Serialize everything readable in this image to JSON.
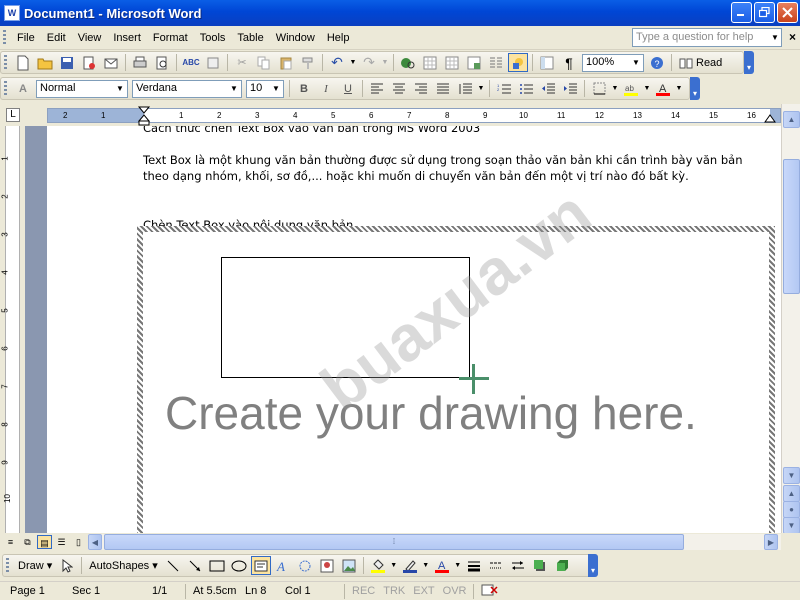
{
  "window": {
    "app_icon_text": "W",
    "title": "Document1 - Microsoft Word",
    "controls": [
      "minimize",
      "maximize",
      "close"
    ]
  },
  "menubar": {
    "items": [
      "File",
      "Edit",
      "View",
      "Insert",
      "Format",
      "Tools",
      "Table",
      "Window",
      "Help"
    ],
    "ask_placeholder": "Type a question for help"
  },
  "standard_toolbar": {
    "zoom": "100%",
    "read_label": "Read"
  },
  "formatting_toolbar": {
    "style": "Normal",
    "font": "Verdana",
    "size": "10",
    "bold": "B",
    "italic": "I",
    "underline": "U"
  },
  "ruler": {
    "tab_selector": "L",
    "ticks": [
      "2",
      "1",
      "1",
      "2",
      "3",
      "4",
      "5",
      "6",
      "7",
      "8",
      "9",
      "10",
      "11",
      "12",
      "13",
      "14",
      "15",
      "16"
    ],
    "vertical_ticks": [
      "1",
      "2",
      "3",
      "4",
      "5",
      "6",
      "7",
      "8",
      "9",
      "10"
    ]
  },
  "document": {
    "heading_partial": "Cách thức chèn Text Box vào văn bản trong MS Word 2003",
    "paragraph": "Text Box là một khung văn bản thường được sử dụng trong soạn thảo văn bản khi cần trình bày văn bản theo dạng nhóm, khối, sơ đồ,... hoặc khi muốn di chuyển văn bản đến một vị trí nào đó bất kỳ.",
    "subheading": "Chèn Text Box vào nội dung văn bản",
    "canvas_hint": "Create your drawing here.",
    "watermark": "buaxua.vn"
  },
  "drawing_toolbar": {
    "draw_label": "Draw",
    "autoshapes_label": "AutoShapes"
  },
  "statusbar": {
    "page": "Page 1",
    "section": "Sec 1",
    "pages": "1/1",
    "at": "At 5.5cm",
    "line": "Ln 8",
    "col": "Col 1",
    "rec": "REC",
    "trk": "TRK",
    "ext": "EXT",
    "ovr": "OVR"
  },
  "colors": {
    "titlebar": "#0046d5",
    "font_color_underline": "#ff0000",
    "highlight_underline": "#ffff00",
    "canvas_hatch": "#777777",
    "drawing_hint": "#808080"
  }
}
